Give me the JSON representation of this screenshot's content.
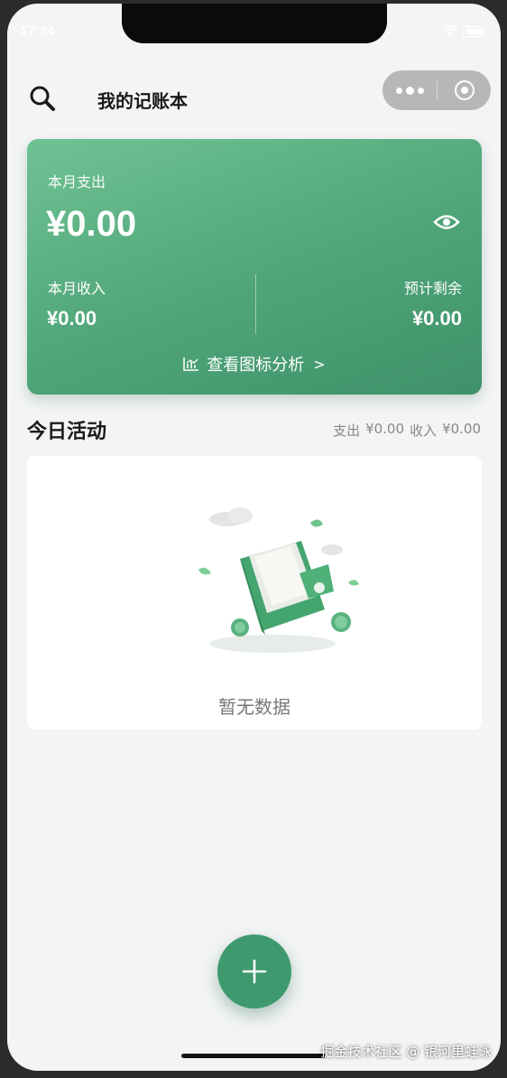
{
  "status_bar": {
    "time": "17:34"
  },
  "nav": {
    "title": "我的记账本"
  },
  "summary_card": {
    "expense_label": "本月支出",
    "expense_amount": "¥0.00",
    "income_label": "本月收入",
    "income_amount": "¥0.00",
    "remaining_label": "预计剩余",
    "remaining_amount": "¥0.00",
    "chart_link": "查看图标分析",
    "chart_link_chevron": ">",
    "gradient_colors": [
      "#6fc293",
      "#3f9169"
    ]
  },
  "today": {
    "title": "今日活动",
    "expense_label": "支出",
    "expense_value": "¥0.00",
    "income_label": "收入",
    "income_value": "¥0.00",
    "empty_text": "暂无数据"
  },
  "fab": {
    "icon": "plus-icon",
    "color": "#3e9a6e"
  },
  "watermark": "掘金技术社区 @ 银河里蛙泳"
}
